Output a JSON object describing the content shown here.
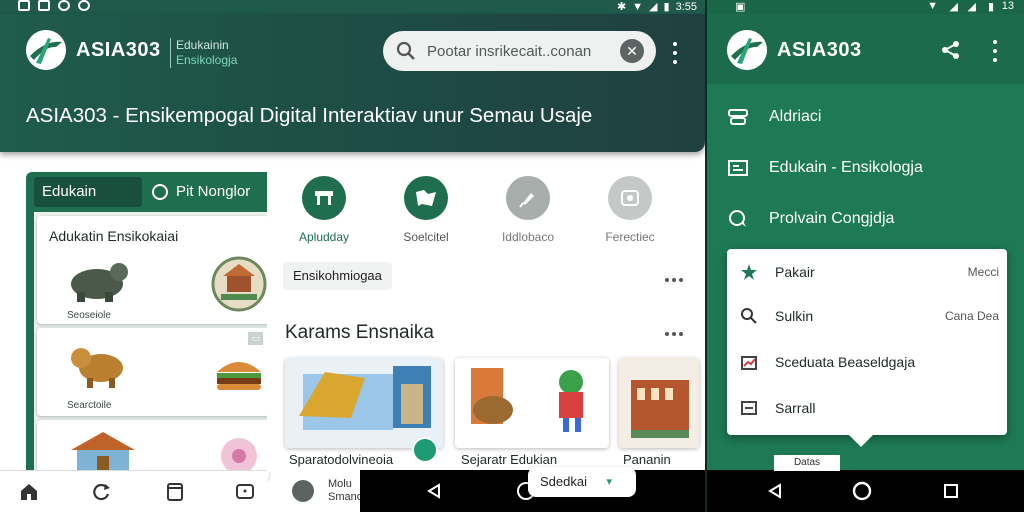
{
  "app": {
    "brand": "ASIA303",
    "subtitle_line1": "Edukainin",
    "subtitle_line2": "Ensikologja",
    "headline": "ASIA303 - Ensikempogal Digital Interaktiav unur Semau Usaje"
  },
  "status_bar": {
    "time": "3:55",
    "time_right": "13"
  },
  "search": {
    "placeholder": "Pootar insrikecait..conan"
  },
  "left_panel": {
    "tab_active": "Edukain",
    "tab_other": "Pit Nonglor",
    "card_title": "Adukatin Ensikokaiai",
    "cards": [
      {
        "caption": "Seoseiole"
      },
      {
        "caption": "Searctoile"
      },
      {
        "caption": ""
      }
    ]
  },
  "categories": [
    {
      "label": "Apludday",
      "color": "#1f6e4f",
      "label_color": "#1f6e4f",
      "icon": "table-icon"
    },
    {
      "label": "Soelcitel",
      "color": "#1f6e4f",
      "label_color": "#555555",
      "icon": "map-icon"
    },
    {
      "label": "Iddlobaco",
      "color": "#a8aeac",
      "label_color": "#777777",
      "icon": "pin-icon"
    },
    {
      "label": "Ferectiec",
      "color": "#c4c9c7",
      "label_color": "#777777",
      "icon": "book-icon"
    }
  ],
  "chip_ensiko": "Ensikohmiogaa",
  "section_title": "Karams Ensnaika",
  "thumbs": [
    {
      "caption": "Sparatodolvineoia"
    },
    {
      "caption": "Sejaratr Edukian"
    },
    {
      "caption": "Pananin"
    }
  ],
  "mini_player": {
    "line1": "Molu",
    "line2": "Smano"
  },
  "chip_float": {
    "label": "Sdedkai"
  },
  "drawer": {
    "items": [
      {
        "label": "Aldriaci",
        "icon": "layers-icon"
      },
      {
        "label": "Edukain - Ensikologja",
        "icon": "monitor-icon"
      },
      {
        "label": "Prolvain Congjdja",
        "icon": "chat-icon"
      }
    ]
  },
  "popup": {
    "items": [
      {
        "label": "Pakair",
        "right": "Mecci",
        "icon": "star-icon",
        "icon_color": "#1e7a55"
      },
      {
        "label": "Sulkin",
        "right": "Cana Dea",
        "icon": "search-icon",
        "icon_color": "#333333"
      },
      {
        "label": "Sceduata Beaseldgaja",
        "right": "",
        "icon": "report-icon",
        "icon_color": "#444444"
      },
      {
        "label": "Sarrall",
        "right": "",
        "icon": "list-icon",
        "icon_color": "#444444"
      }
    ]
  },
  "bottom_small_label": "Datas",
  "colors": {
    "primary": "#1e7a55",
    "appbar": "#1f5c4b",
    "accent": "#1d9b73"
  }
}
